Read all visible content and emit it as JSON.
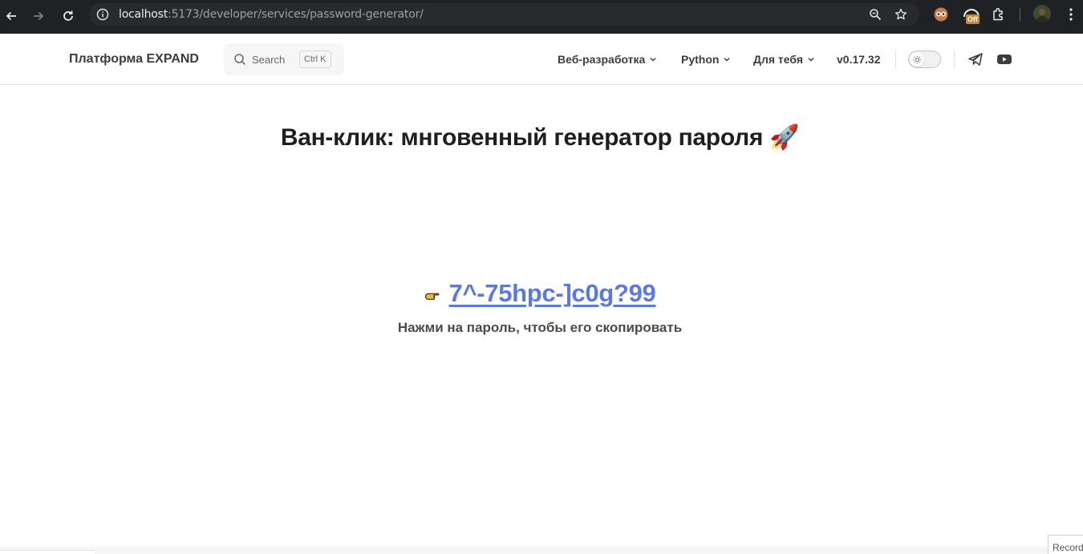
{
  "browser": {
    "url_host": "localhost",
    "url_path": ":5173/developer/services/password-generator/",
    "extension_badge": "Off",
    "colors": {
      "frame": "#202124",
      "omnibox": "#282a2d"
    }
  },
  "header": {
    "brand": "Платформа EXPAND",
    "search": {
      "label": "Search",
      "shortcut": "Ctrl K"
    },
    "menu": [
      {
        "label": "Веб-разработка",
        "icon": "chevron-down-icon"
      },
      {
        "label": "Python",
        "icon": "chevron-down-icon"
      },
      {
        "label": "Для тебя",
        "icon": "chevron-down-icon"
      }
    ],
    "version": "v0.17.32",
    "theme_toggle": {
      "state": "light",
      "icon": "sun-icon"
    },
    "social": [
      "telegram-icon",
      "youtube-icon"
    ]
  },
  "main": {
    "title": "Ван-клик: мнговенный генератор пароля 🚀",
    "password": "7^-75hpc-]c0g?99",
    "password_icon": "pointing-hand-icon",
    "hint": "Нажми на пароль, чтобы его скопировать",
    "accent_color": "#5b7ae0"
  },
  "footer": {
    "record_label": "Record"
  }
}
